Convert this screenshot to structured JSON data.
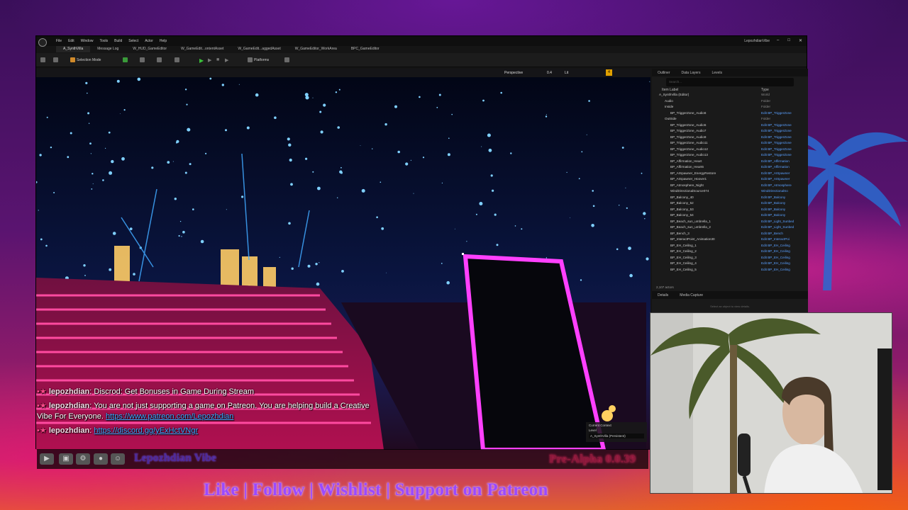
{
  "editor": {
    "menu": [
      "File",
      "Edit",
      "Window",
      "Tools",
      "Build",
      "Select",
      "Actor",
      "Help"
    ],
    "window_title": "LepozhdianVibe",
    "level_tab": "A_SynthVilla",
    "tabs": [
      "Message Log",
      "W_HUD_GameEditor",
      "W_GameEdit...ontentAsset",
      "W_GameEdit...aggedAsset",
      "W_GameEditor_WorkArea",
      "BPC_GameEditor"
    ],
    "toolbar": {
      "selection_mode": "Selection Mode",
      "platforms": "Platforms"
    },
    "viewport": {
      "perspective": "Perspective",
      "lit": "Lit",
      "snap": "0.4",
      "tag": "4"
    }
  },
  "outliner": {
    "tabs": [
      "Outliner",
      "Data Layers",
      "Levels"
    ],
    "search_placeholder": "Search...",
    "col_label": "Item Label",
    "col_type": "Type",
    "rows": [
      {
        "name": "A_SynthVilla (Editor)",
        "type": "World",
        "folder": true
      },
      {
        "name": "Audio",
        "type": "Folder",
        "folder": true
      },
      {
        "name": "Inside",
        "type": "Folder",
        "folder": true
      },
      {
        "name": "BP_TriggerZone_Audio6",
        "type": "Edit BP_TriggerZone"
      },
      {
        "name": "OutSide",
        "type": "Folder",
        "folder": true
      },
      {
        "name": "BP_TriggerZone_Audio5",
        "type": "Edit BP_TriggerZone"
      },
      {
        "name": "BP_TriggerZone_Audio7",
        "type": "Edit BP_TriggerZone"
      },
      {
        "name": "BP_TriggerZone_Audio9",
        "type": "Edit BP_TriggerZone"
      },
      {
        "name": "BP_TriggerZone_Audio11",
        "type": "Edit BP_TriggerZone"
      },
      {
        "name": "BP_TriggerZone_Audio12",
        "type": "Edit BP_TriggerZone"
      },
      {
        "name": "BP_TriggerZone_Audio13",
        "type": "Edit BP_TriggerZone"
      },
      {
        "name": "BP_Affirmation_Heart",
        "type": "Edit BP_Affirmation"
      },
      {
        "name": "BP_Affirmation_Heart6",
        "type": "Edit BP_Affirmation"
      },
      {
        "name": "BP_AISpawner_EnergyRestore",
        "type": "Edit BP_AISpawner"
      },
      {
        "name": "BP_AISpawner_Hoover1",
        "type": "Edit BP_AISpawner"
      },
      {
        "name": "BP_Atmosphere_Night",
        "type": "Edit BP_Atmosphere"
      },
      {
        "name": "WindDirectionalSource074",
        "type": "WindDirectionalSo"
      },
      {
        "name": "BP_Balcony_40",
        "type": "Edit BP_Balcony"
      },
      {
        "name": "BP_Balcony_52",
        "type": "Edit BP_Balcony"
      },
      {
        "name": "BP_Balcony_53",
        "type": "Edit BP_Balcony"
      },
      {
        "name": "BP_Balcony_54",
        "type": "Edit BP_Balcony"
      },
      {
        "name": "BP_Beach_sun_umbrella_1",
        "type": "Edit BP_Light_Sunbed"
      },
      {
        "name": "BP_Beach_sun_umbrella_2",
        "type": "Edit BP_Light_Sunbed"
      },
      {
        "name": "BP_Bench_3",
        "type": "Edit BP_Bench"
      },
      {
        "name": "BP_InteractPoint_Animation30",
        "type": "Edit BP_InteractPoi"
      },
      {
        "name": "BP_EH_Ceiling_1",
        "type": "Edit BP_EH_Ceiling"
      },
      {
        "name": "BP_EH_Ceiling_2",
        "type": "Edit BP_EH_Ceiling"
      },
      {
        "name": "BP_EH_Ceiling_3",
        "type": "Edit BP_EH_Ceiling"
      },
      {
        "name": "BP_EH_Ceiling_4",
        "type": "Edit BP_EH_Ceiling"
      },
      {
        "name": "BP_EH_Ceiling_5",
        "type": "Edit BP_EH_Ceiling"
      }
    ],
    "actor_count": "2,107 actors"
  },
  "details": {
    "tabs": [
      "Details",
      "Media Capture"
    ],
    "empty": "Select an object to view details."
  },
  "current_context": {
    "title": "Current Context",
    "level": "Level",
    "value": "A_SynthVilla (Persistent)"
  },
  "chat": [
    {
      "user": "lepozhdian",
      "text": "Discrod: Get Bonuses in Game During Stream",
      "link": ""
    },
    {
      "user": "lepozhdian",
      "text": "You are not just supporting a game on Patreon. You are helping build a Creative Vibe For Everyone.",
      "link": "https://www.patreon.com/Lepozhdian"
    },
    {
      "user": "lepozhdian",
      "text": "",
      "link": "https://discord.gg/yExHctVNgr"
    }
  ],
  "overlay": {
    "channel": "Lepozhdian Vibe",
    "version": "Pre-Alpha 0.0.39",
    "cta": "Like | Follow | Wishlist | Support on Patreon"
  },
  "social_icons": [
    "youtube-icon",
    "twitch-icon",
    "steam-icon",
    "patreon-icon",
    "discord-icon"
  ]
}
